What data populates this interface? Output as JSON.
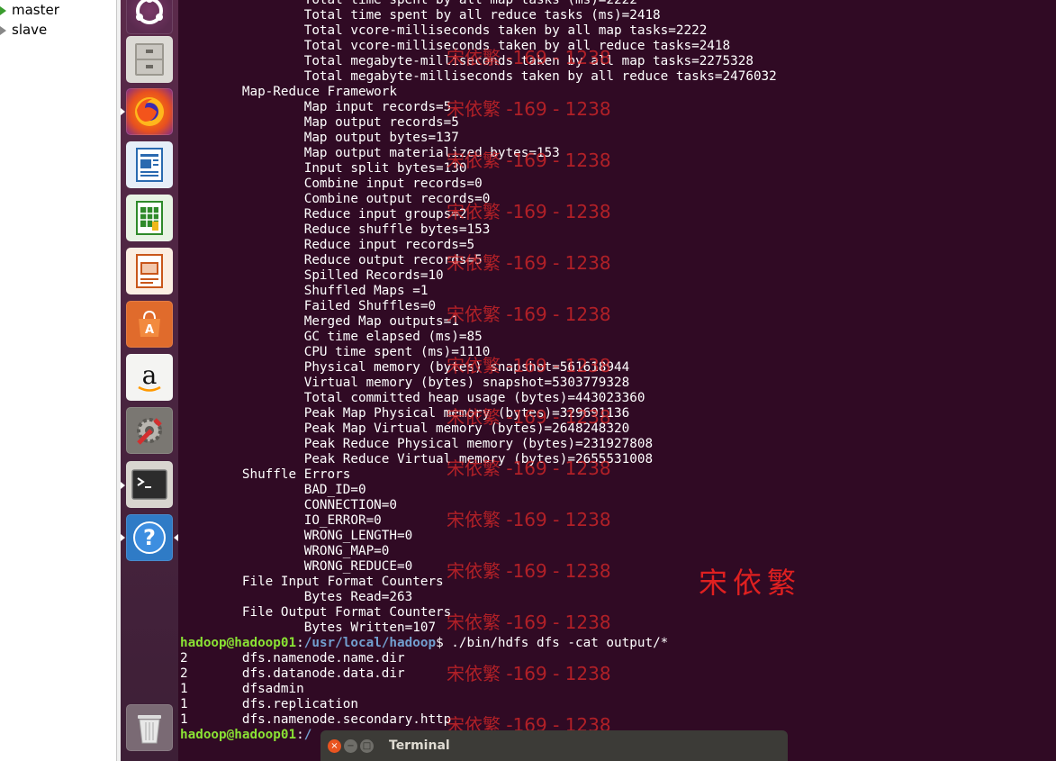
{
  "vm_list": {
    "items": [
      {
        "label": "master",
        "running": true
      },
      {
        "label": "slave",
        "running": false
      }
    ]
  },
  "launcher": {
    "apps": [
      "ubuntu-icon",
      "files-icon",
      "firefox-icon",
      "writer-icon",
      "calc-icon",
      "impress-icon",
      "software-center-icon",
      "amazon-icon",
      "settings-icon",
      "terminal-icon",
      "help-icon",
      "trash-icon"
    ]
  },
  "terminal": {
    "title": "Terminal",
    "lines": [
      "                Total time spent by all map tasks (ms)=2222",
      "                Total time spent by all reduce tasks (ms)=2418",
      "                Total vcore-milliseconds taken by all map tasks=2222",
      "                Total vcore-milliseconds taken by all reduce tasks=2418",
      "                Total megabyte-milliseconds taken by all map tasks=2275328",
      "                Total megabyte-milliseconds taken by all reduce tasks=2476032",
      "        Map-Reduce Framework",
      "                Map input records=5",
      "                Map output records=5",
      "                Map output bytes=137",
      "                Map output materialized bytes=153",
      "                Input split bytes=130",
      "                Combine input records=0",
      "                Combine output records=0",
      "                Reduce input groups=2",
      "                Reduce shuffle bytes=153",
      "                Reduce input records=5",
      "                Reduce output records=5",
      "                Spilled Records=10",
      "                Shuffled Maps =1",
      "                Failed Shuffles=0",
      "                Merged Map outputs=1",
      "                GC time elapsed (ms)=85",
      "                CPU time spent (ms)=1110",
      "                Physical memory (bytes) snapshot=561618944",
      "                Virtual memory (bytes) snapshot=5303779328",
      "                Total committed heap usage (bytes)=443023360",
      "                Peak Map Physical memory (bytes)=329691136",
      "                Peak Map Virtual memory (bytes)=2648248320",
      "                Peak Reduce Physical memory (bytes)=231927808",
      "                Peak Reduce Virtual memory (bytes)=2655531008",
      "        Shuffle Errors",
      "                BAD_ID=0",
      "                CONNECTION=0",
      "                IO_ERROR=0",
      "                WRONG_LENGTH=0",
      "                WRONG_MAP=0",
      "                WRONG_REDUCE=0",
      "        File Input Format Counters",
      "                Bytes Read=263",
      "        File Output Format Counters",
      "                Bytes Written=107"
    ],
    "prompt1": {
      "user": "hadoop@hadoop01",
      "sep": ":",
      "path": "/usr/local/hadoop",
      "cmd": "$ ./bin/hdfs dfs -cat output/*"
    },
    "output": [
      "2       dfs.namenode.name.dir",
      "2       dfs.datanode.data.dir",
      "1       dfsadmin",
      "1       dfs.replication",
      "1       dfs.namenode.secondary.http"
    ],
    "prompt2": {
      "user": "hadoop@hadoop01",
      "sep": ":",
      "path": "/"
    }
  },
  "watermark": {
    "text": "宋依繁 -169 - 1238",
    "big": "宋依繁"
  },
  "colors": {
    "terminal_bg": "#300a24",
    "prompt_user": "#8ae234",
    "prompt_path": "#729fcf",
    "watermark": "#e02020"
  }
}
